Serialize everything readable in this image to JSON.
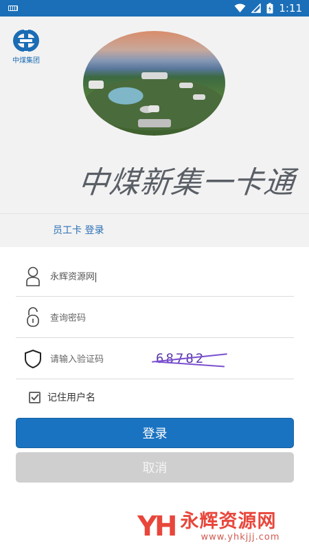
{
  "status_bar": {
    "time": "1:11",
    "icons": [
      "keyboard-icon",
      "wifi-icon",
      "signal-icon",
      "battery-charging-icon"
    ]
  },
  "header": {
    "logo_text": "中煤集团",
    "app_title": "中煤新集一卡通"
  },
  "tab": {
    "label": "员工卡 登录"
  },
  "form": {
    "username": {
      "value": "永辉资源网",
      "icon": "user-icon"
    },
    "password": {
      "placeholder": "查询密码",
      "icon": "lock-icon"
    },
    "captcha": {
      "placeholder": "请输入验证码",
      "icon": "shield-icon",
      "image_text": "68782"
    },
    "remember": {
      "label": "记住用户名",
      "checked": true
    }
  },
  "buttons": {
    "login": "登录",
    "cancel": "取消"
  },
  "watermark": {
    "logo": "YH",
    "title": "永辉资源网",
    "url": "www.yhkjjj.com"
  },
  "colors": {
    "status_bar": "#1b6fb8",
    "primary": "#1a73c1",
    "tab_text": "#2a6fb6",
    "cancel": "#cfcfcf",
    "watermark": "#e8463b"
  }
}
